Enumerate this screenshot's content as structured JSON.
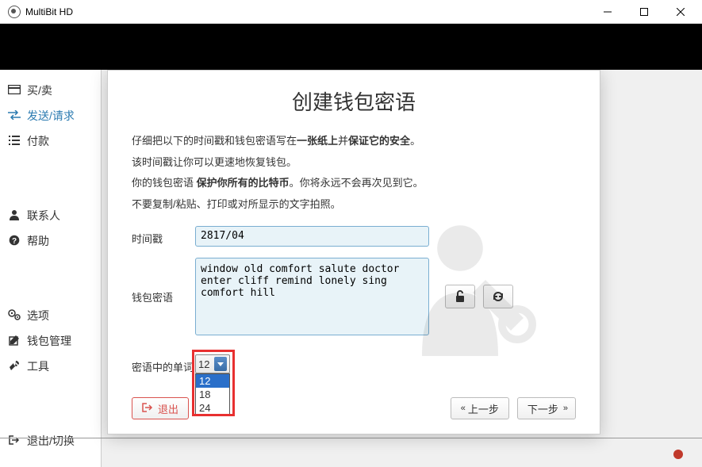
{
  "window": {
    "title": "MultiBit HD"
  },
  "sidebar": {
    "items": [
      {
        "label": "买/卖"
      },
      {
        "label": "发送/请求"
      },
      {
        "label": "付款"
      },
      {
        "label": "联系人"
      },
      {
        "label": "帮助"
      },
      {
        "label": "选项"
      },
      {
        "label": "钱包管理"
      },
      {
        "label": "工具"
      },
      {
        "label": "退出/切换"
      }
    ]
  },
  "modal": {
    "title": "创建钱包密语",
    "line1a": "仔细把以下的时间戳和钱包密语写在",
    "line1b": "一张纸上",
    "line1c": "并",
    "line1d": "保证它的安全",
    "line1e": "。",
    "line2": "该时间戳让你可以更速地恢复钱包。",
    "line3a": "你的钱包密语 ",
    "line3b": "保护你所有的比特币",
    "line3c": "。你将永远不会再次见到它。",
    "line4": "不要复制/粘贴、打印或对所显示的文字拍照。",
    "timestamp_label": "时间戳",
    "timestamp_value": "2817/04",
    "seed_label": "钱包密语",
    "seed_value": "window old comfort salute doctor enter cliff remind lonely sing comfort hill",
    "count_label": "密语中的单词",
    "count_value": "12",
    "count_options": [
      "12",
      "18",
      "24"
    ],
    "exit_label": "退出",
    "prev_label": "上一步",
    "next_label": "下一步"
  }
}
